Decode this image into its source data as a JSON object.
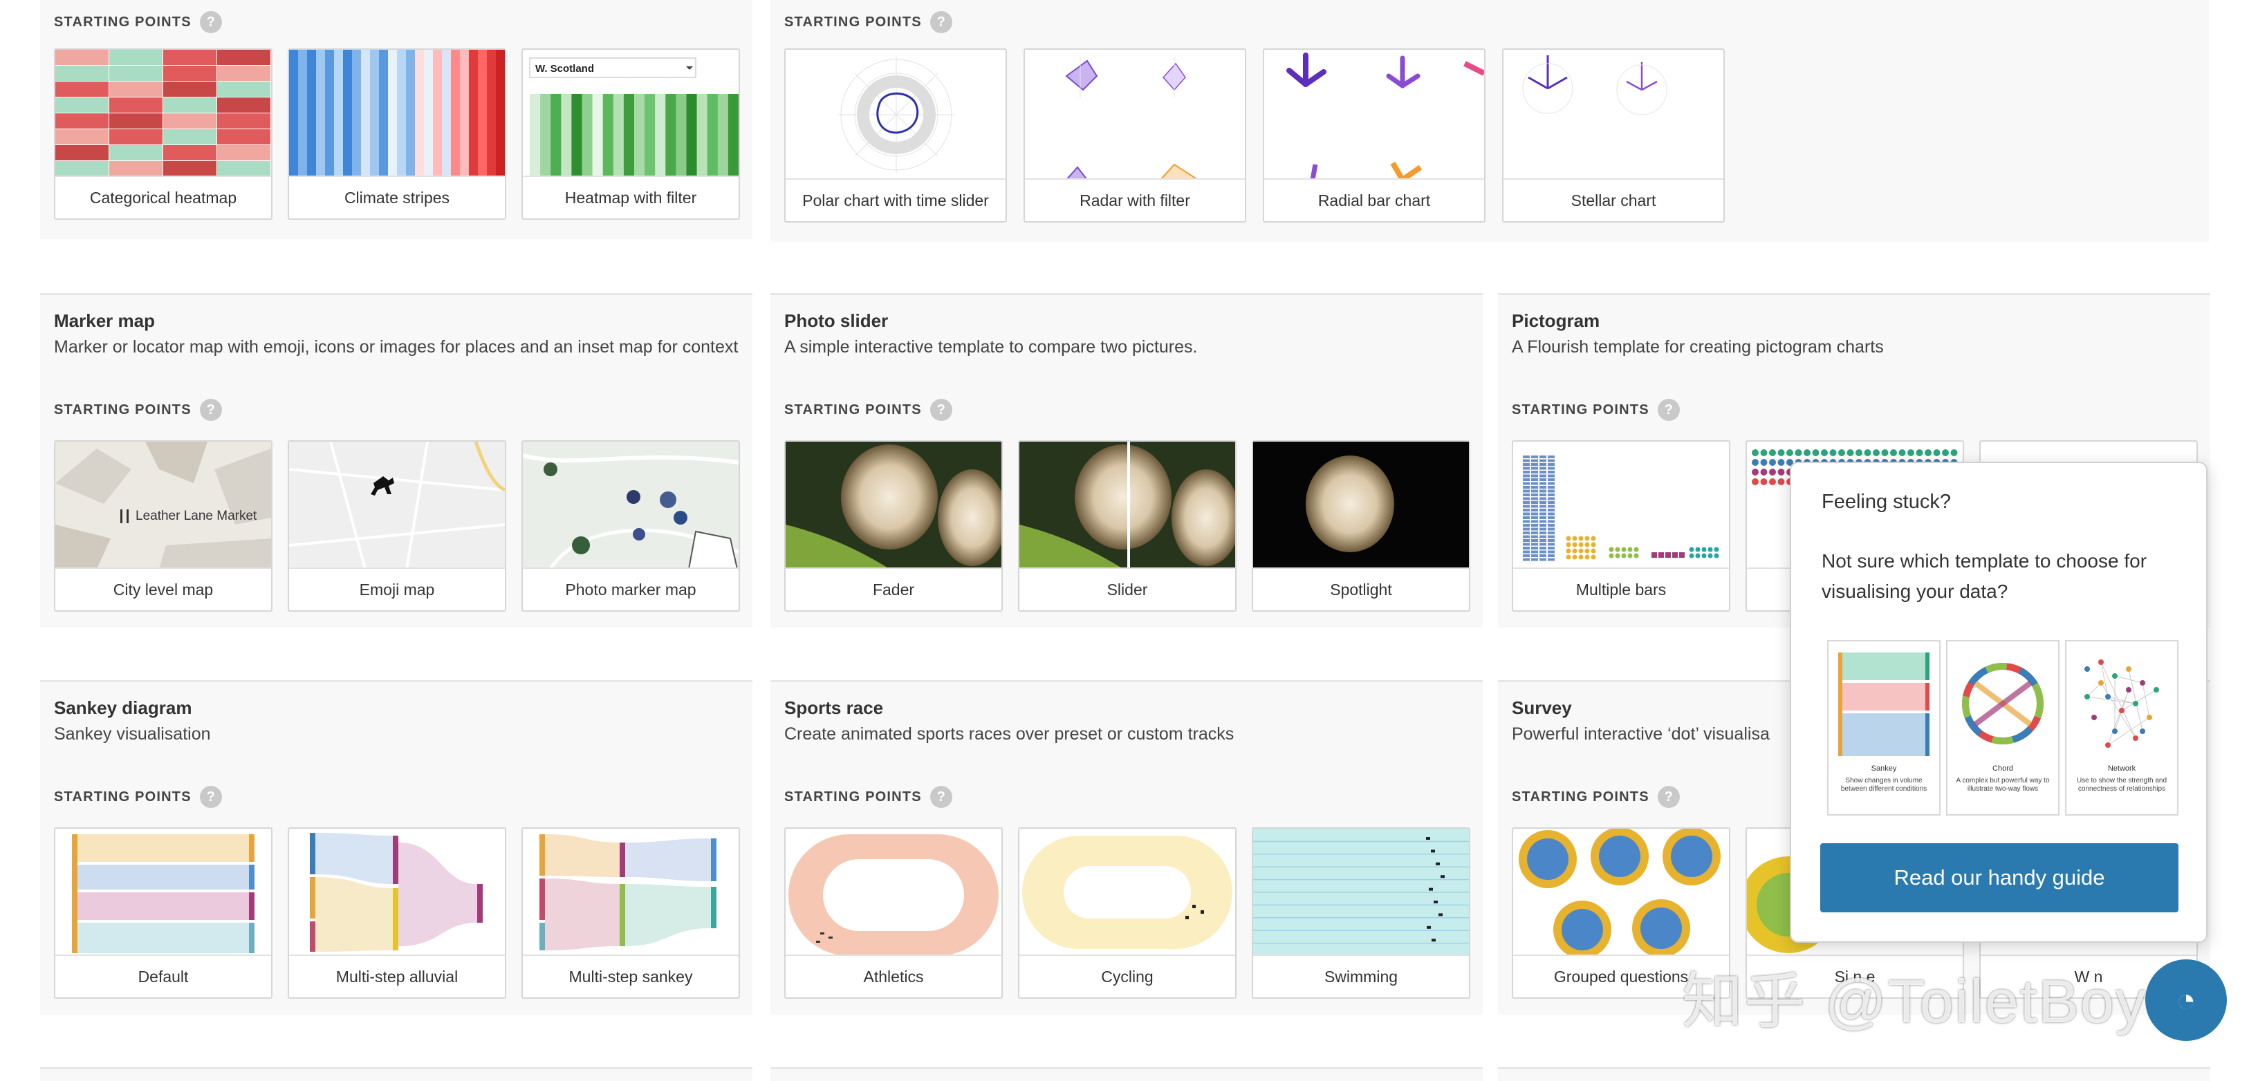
{
  "starting_points_label": "STARTING POINTS",
  "help_glyph": "?",
  "sections": [
    {
      "id": "heatmap",
      "title": "",
      "description": "",
      "cards": [
        "Categorical heatmap",
        "Climate stripes",
        "Heatmap with filter"
      ],
      "filter_value": "W. Scotland"
    },
    {
      "id": "radar",
      "title": "",
      "description": "",
      "cards": [
        "Polar chart with time slider",
        "Radar with filter",
        "Radial bar chart",
        "Stellar chart"
      ]
    },
    {
      "id": "marker-map",
      "title": "Marker map",
      "description": "Marker or locator map with emoji, icons or images for places and an inset map for context",
      "cards": [
        "City level map",
        "Emoji map",
        "Photo marker map"
      ],
      "map_label": "Leather Lane Market"
    },
    {
      "id": "photo-slider",
      "title": "Photo slider",
      "description": "A simple interactive template to compare two pictures.",
      "cards": [
        "Fader",
        "Slider",
        "Spotlight"
      ]
    },
    {
      "id": "pictogram",
      "title": "Pictogram",
      "description": "A Flourish template for creating pictogram charts",
      "cards": [
        "Multiple bars",
        "",
        ""
      ]
    },
    {
      "id": "sankey",
      "title": "Sankey diagram",
      "description": "Sankey visualisation",
      "cards": [
        "Default",
        "Multi-step alluvial",
        "Multi-step sankey"
      ]
    },
    {
      "id": "sports-race",
      "title": "Sports race",
      "description": "Create animated sports races over preset or custom tracks",
      "cards": [
        "Athletics",
        "Cycling",
        "Swimming"
      ]
    },
    {
      "id": "survey",
      "title": "Survey",
      "description": "Powerful interactive ‘dot’ visualisa",
      "cards": [
        "Grouped questions",
        "Si   n e",
        "W    n"
      ]
    }
  ],
  "popup": {
    "heading": "Feeling stuck?",
    "text": "Not sure which template to choose for visualising your data?",
    "guides": [
      {
        "name": "Sankey",
        "desc": "Show changes in volume between different conditions"
      },
      {
        "name": "Chord",
        "desc": "A complex but powerful way to illustrate two-way flows"
      },
      {
        "name": "Network",
        "desc": "Use to show the strength and connectness of relationships"
      }
    ],
    "button": "Read our handy guide"
  },
  "watermark": "知乎 @ToiletBoy",
  "colors": {
    "accent": "#2a7ab0",
    "heat_red": "#e05b5b",
    "heat_green": "#a9dcc3",
    "stripe_blue": "#3f86d8",
    "stripe_red": "#e03a3a",
    "radar_purple": "#8a4bd6"
  }
}
